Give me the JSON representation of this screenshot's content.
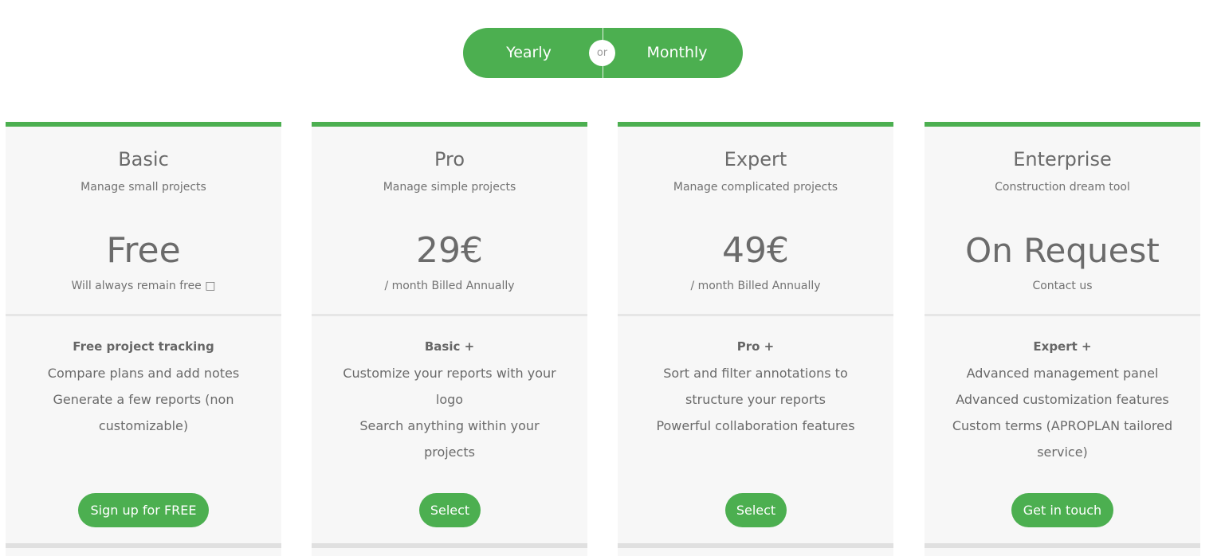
{
  "billing_toggle": {
    "yearly_label": "Yearly",
    "or_label": "or",
    "monthly_label": "Monthly"
  },
  "plans": [
    {
      "name": "Basic",
      "description": "Manage small projects",
      "price": "Free",
      "price_note": "Will always remain free □",
      "features_headline": "Free project tracking",
      "features": [
        "Compare plans and add notes",
        "Generate a few reports (non",
        "customizable)"
      ],
      "cta": "Sign up for FREE"
    },
    {
      "name": "Pro",
      "description": "Manage simple projects",
      "price": "29€",
      "price_note": "/ month Billed Annually",
      "features_headline": "Basic +",
      "features": [
        "Customize your reports with your",
        "logo",
        "Search anything within your projects"
      ],
      "cta": "Select"
    },
    {
      "name": "Expert",
      "description": "Manage complicated projects",
      "price": "49€",
      "price_note": "/ month Billed Annually",
      "features_headline": "Pro +",
      "features": [
        "Sort and filter annotations to",
        "structure your reports",
        "Powerful collaboration features"
      ],
      "cta": "Select"
    },
    {
      "name": "Enterprise",
      "description": "Construction dream tool",
      "price": "On Request",
      "price_note": "Contact us",
      "features_headline": "Expert +",
      "features": [
        "Advanced management panel",
        "Advanced customization features",
        "Custom terms (APROPLAN tailored",
        "service)"
      ],
      "cta": "Get in touch"
    }
  ],
  "colors": {
    "accent": "#4caf50",
    "card_background": "#f7f7f7",
    "text": "#666666"
  }
}
